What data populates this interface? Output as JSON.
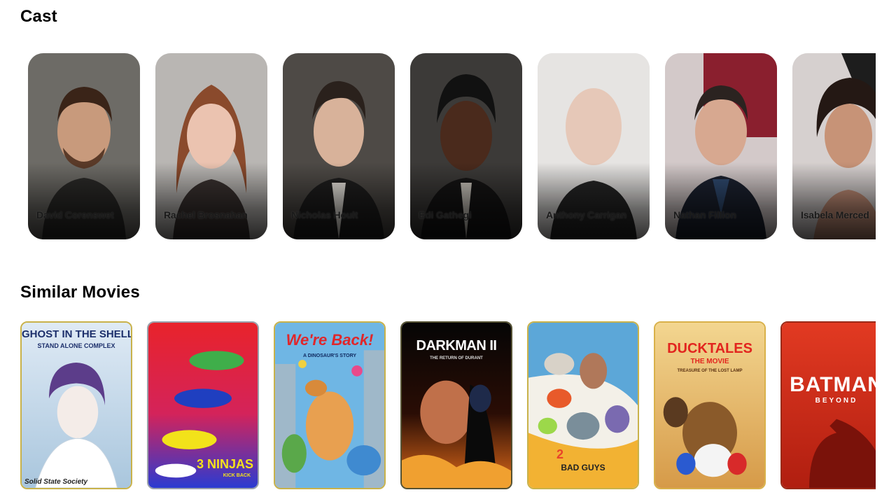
{
  "sections": {
    "cast_title": "Cast",
    "similar_title": "Similar Movies"
  },
  "cast": [
    {
      "name": "David Corenswet"
    },
    {
      "name": "Rachel Brosnahan"
    },
    {
      "name": "Nicholas Hoult"
    },
    {
      "name": "Edi Gathegi"
    },
    {
      "name": "Anthony Carrigan"
    },
    {
      "name": "Nathan Fillion"
    },
    {
      "name": "Isabela Merced"
    }
  ],
  "movies": [
    {
      "title": "Ghost in the Shell: Stand Alone Complex - Solid State Society",
      "poster_text": "GHOST IN THE SHELL",
      "poster_sub": "STAND ALONE COMPLEX",
      "poster_foot": "Solid State Society",
      "colors": [
        "#cfe3f2",
        "#7a6bb5"
      ]
    },
    {
      "title": "3 Ninjas Kick Back",
      "poster_text": "3 NINJAS",
      "poster_sub": "KICK BACK",
      "colors": [
        "#e8232b",
        "#2b3bd1"
      ]
    },
    {
      "title": "We're Back! A Dinosaur's Story",
      "poster_text": "We're Back!",
      "poster_sub": "A DINOSAUR'S STORY",
      "colors": [
        "#6fb6e4",
        "#d9a066"
      ]
    },
    {
      "title": "Darkman II: The Return of Durant",
      "poster_text": "DARKMAN II",
      "poster_sub": "THE RETURN OF DURANT",
      "colors": [
        "#0c0c0c",
        "#d95a1c"
      ]
    },
    {
      "title": "The Bad Guys 2",
      "poster_text": "BAD GUYS",
      "poster_sub": "2",
      "colors": [
        "#f3f0e8",
        "#f2b233"
      ]
    },
    {
      "title": "DuckTales the Movie: Treasure of the Lost Lamp",
      "poster_text": "DUCKTALES",
      "poster_sub": "THE MOVIE",
      "poster_foot": "TREASURE OF THE LOST LAMP",
      "colors": [
        "#f0c875",
        "#b5652a"
      ]
    },
    {
      "title": "Batman Beyond",
      "poster_text": "BATMAN",
      "poster_sub": "BEYOND",
      "colors": [
        "#d8331f",
        "#8a160e"
      ]
    }
  ]
}
